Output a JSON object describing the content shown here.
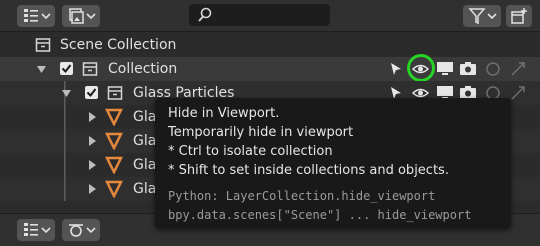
{
  "header": {
    "display_mode_icon": "view-layer-list-icon",
    "view_layer_icon": "image-stack-icon",
    "search_icon": "magnifier-icon",
    "search_value": "",
    "filter_icon": "funnel-icon",
    "new_collection_icon": "new-collection-icon"
  },
  "outliner": {
    "scene_collection_label": "Scene Collection",
    "collection_label": "Collection",
    "children": [
      {
        "label": "Glass Particles"
      },
      {
        "label": "Glass"
      },
      {
        "label": "Glass"
      },
      {
        "label": "Glass"
      },
      {
        "label": "Glass"
      }
    ]
  },
  "tooltip": {
    "title": "Hide in Viewport.",
    "description": "Temporarily hide in viewport",
    "hint_ctrl": "* Ctrl to isolate collection",
    "hint_shift": "* Shift to set inside collections and objects.",
    "python_line_1": "Python: LayerCollection.hide_viewport",
    "python_line_2": "bpy.data.scenes[\"Scene\"] ... hide_viewport"
  },
  "colors": {
    "highlight_ring": "#27d327",
    "orange_object": "#e8893a"
  }
}
